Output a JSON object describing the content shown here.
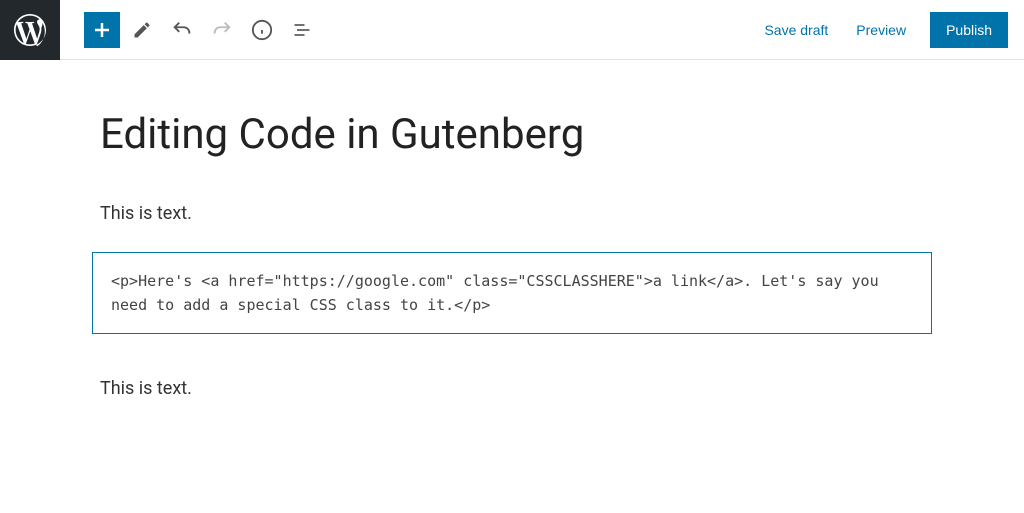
{
  "toolbar": {
    "save_draft_label": "Save draft",
    "preview_label": "Preview",
    "publish_label": "Publish"
  },
  "post": {
    "title": "Editing Code in Gutenberg",
    "blocks": {
      "para1": "This is text.",
      "code": "<p>Here's <a href=\"https://google.com\" class=\"CSSCLASSHERE\">a link</a>. Let's say you need to add a special CSS class to it.</p>",
      "para2": "This is text."
    }
  }
}
